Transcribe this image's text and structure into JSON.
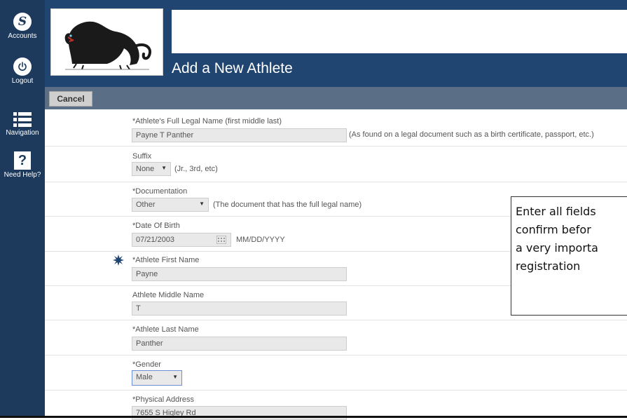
{
  "sidebar": {
    "accounts_label": "Accounts",
    "logout_label": "Logout",
    "navigation_label": "Navigation",
    "help_label": "Need Help?",
    "help_glyph": "?",
    "accounts_glyph": "S"
  },
  "header": {
    "title": "Add a New Athlete"
  },
  "toolbar": {
    "cancel_label": "Cancel"
  },
  "form": {
    "full_name": {
      "label": "*Athlete's Full Legal Name (first middle last)",
      "value": "Payne T Panther",
      "hint": "(As found on a legal document such as a birth certificate, passport, etc.)"
    },
    "suffix": {
      "label": "Suffix",
      "value": "None",
      "hint": "(Jr., 3rd, etc)"
    },
    "documentation": {
      "label": "*Documentation",
      "value": "Other",
      "hint": "(The document that has the full legal name)"
    },
    "dob": {
      "label": "*Date Of Birth",
      "value": "07/21/2003",
      "hint": "MM/DD/YYYY"
    },
    "first_name": {
      "label": "*Athlete First Name",
      "value": "Payne"
    },
    "middle_name": {
      "label": "Athlete Middle Name",
      "value": "T"
    },
    "last_name": {
      "label": "*Athlete Last Name",
      "value": "Panther"
    },
    "gender": {
      "label": "*Gender",
      "value": "Male"
    },
    "address": {
      "label": "*Physical Address",
      "value": "7655 S Higley Rd"
    }
  },
  "tooltip": {
    "text": "Enter all fields\nconfirm befor\na very importa\nregistration"
  },
  "colors": {
    "sidebar_bg": "#1d3a5c",
    "header_bg": "#1f4570",
    "toolbar_bg": "#5a6f86",
    "marker": "#1f4570"
  },
  "icons": {
    "accounts": "s-logo-icon",
    "logout": "power-icon",
    "navigation": "menu-icon",
    "help": "help-icon",
    "logo": "panther-logo",
    "calendar": "calendar-icon",
    "required_marker": "burst-icon"
  }
}
